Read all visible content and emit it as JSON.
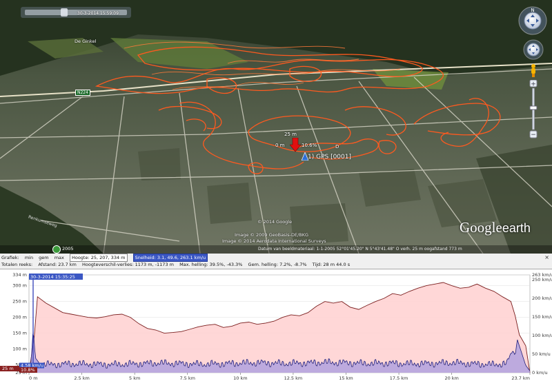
{
  "map": {
    "timestamp": "30-3-2014 15:59:09",
    "place_label": "De Ginkel",
    "road_label": "N224",
    "road_label_lower": "Renkumseweg",
    "marker_elevation": "25 m",
    "marker_left": "0 m",
    "marker_right": "10.6%",
    "marker_name": "1) GPS [0001]",
    "marker_letter": "D",
    "copyright_1": "© 2014 Google",
    "copyright_2": "Image © 2009 GeoBasis-DE/BKG",
    "copyright_3": "Image © 2014 Aerodata International Surveys",
    "logo_google": "Google",
    "logo_earth": "earth",
    "year": "2005",
    "status_bar": "Datum van beeldmateriaal: 1-1-2005    52°01'45.20\" N    5°43'41.48\" O    verh.    25 m    oogafstand    773 m",
    "colors": {
      "track": "#ff5a1f",
      "marker": "#e01010"
    }
  },
  "stats": {
    "row1": [
      "Grafiek:",
      "min",
      "gem",
      "max",
      "Hoogte: 25, 207, 334 m",
      "Snelheid: 3.1, 49.6, 263.1 km/u"
    ],
    "row2": [
      "Totalen reeks:",
      "Afstand: 23.7 km",
      "Hoogteverschil-verlies: 1173 m, -1173 m",
      "Max. helling: 39.5%, -43.3%",
      "Gem. helling: 7.2%, -8.7%",
      "Tijd: 28 m 44.0 s"
    ],
    "close": "×"
  },
  "chart_data": {
    "type": "area",
    "xlabel": "",
    "ylabel": "",
    "x_ticks": [
      "0 m",
      "2.5 km",
      "5 km",
      "7.5 km",
      "10 km",
      "12.5 km",
      "15 km",
      "17.5 km",
      "20 km",
      "23.7 km"
    ],
    "x_tick_values": [
      0,
      2.5,
      5,
      7.5,
      10,
      12.5,
      15,
      17.5,
      20,
      23.7
    ],
    "xlim": [
      0,
      23.7
    ],
    "y_left_ticks": [
      "334 m",
      "300 m",
      "250 m",
      "200 m",
      "150 m",
      "100 m",
      "50 m",
      "25 m"
    ],
    "y_left_values": [
      334,
      300,
      250,
      200,
      150,
      100,
      50,
      25
    ],
    "ylim_left": [
      25,
      334
    ],
    "y_right_ticks": [
      "263 km/u",
      "250 km/u",
      "200 km/u",
      "150 km/u",
      "100 km/u",
      "50 km/u",
      "0 km/u"
    ],
    "y_right_values": [
      263,
      250,
      200,
      150,
      100,
      50,
      0
    ],
    "ylim_right": [
      0,
      263
    ],
    "cursor_label": "30-3-2014 15:35:25",
    "cursor_elev_label": "25 m",
    "cursor_speed_label": "4.58 km/u",
    "cursor_slope_label": "10.8%",
    "series": [
      {
        "name": "Hoogte",
        "color": "#7a1e1e",
        "x": [
          0,
          0.25,
          0.4,
          0.8,
          1.2,
          1.6,
          2.0,
          2.4,
          2.8,
          3.2,
          3.6,
          4.0,
          4.4,
          4.8,
          5.2,
          5.6,
          6.0,
          6.4,
          6.8,
          7.2,
          7.6,
          8.0,
          8.4,
          8.8,
          9.2,
          9.6,
          10.0,
          10.4,
          10.8,
          11.2,
          11.6,
          12.0,
          12.4,
          12.8,
          13.2,
          13.6,
          14.0,
          14.4,
          14.8,
          15.2,
          15.6,
          16.0,
          16.4,
          16.8,
          17.2,
          17.6,
          18.0,
          18.4,
          18.8,
          19.2,
          19.6,
          20.0,
          20.4,
          20.8,
          21.2,
          21.6,
          22.0,
          22.4,
          22.8,
          23.0,
          23.2,
          23.5,
          23.7
        ],
        "y": [
          25,
          140,
          265,
          245,
          230,
          215,
          210,
          205,
          200,
          198,
          202,
          208,
          210,
          200,
          180,
          165,
          160,
          150,
          152,
          155,
          162,
          170,
          175,
          178,
          168,
          172,
          182,
          185,
          178,
          182,
          188,
          200,
          208,
          205,
          215,
          235,
          250,
          245,
          250,
          232,
          225,
          238,
          250,
          260,
          275,
          270,
          282,
          292,
          300,
          305,
          310,
          300,
          292,
          295,
          305,
          292,
          282,
          265,
          250,
          205,
          145,
          110,
          25
        ]
      },
      {
        "name": "Snelheid",
        "color": "#1f1f7a",
        "x": [
          0,
          0.1,
          0.2,
          0.3,
          0.5,
          1.0,
          2.0,
          3.0,
          4.0,
          5.0,
          6.0,
          7.0,
          8.0,
          9.0,
          10.0,
          11.0,
          12.0,
          13.0,
          14.0,
          15.0,
          16.0,
          17.0,
          18.0,
          19.0,
          20.0,
          21.0,
          22.0,
          22.6,
          22.9,
          23.0,
          23.1,
          23.3,
          23.5,
          23.7
        ],
        "y": [
          5,
          30,
          120,
          40,
          25,
          22,
          24,
          23,
          22,
          24,
          26,
          25,
          23,
          24,
          26,
          27,
          25,
          26,
          28,
          27,
          25,
          26,
          24,
          25,
          27,
          24,
          22,
          25,
          60,
          45,
          90,
          55,
          20,
          5
        ],
        "noise": true
      }
    ]
  }
}
